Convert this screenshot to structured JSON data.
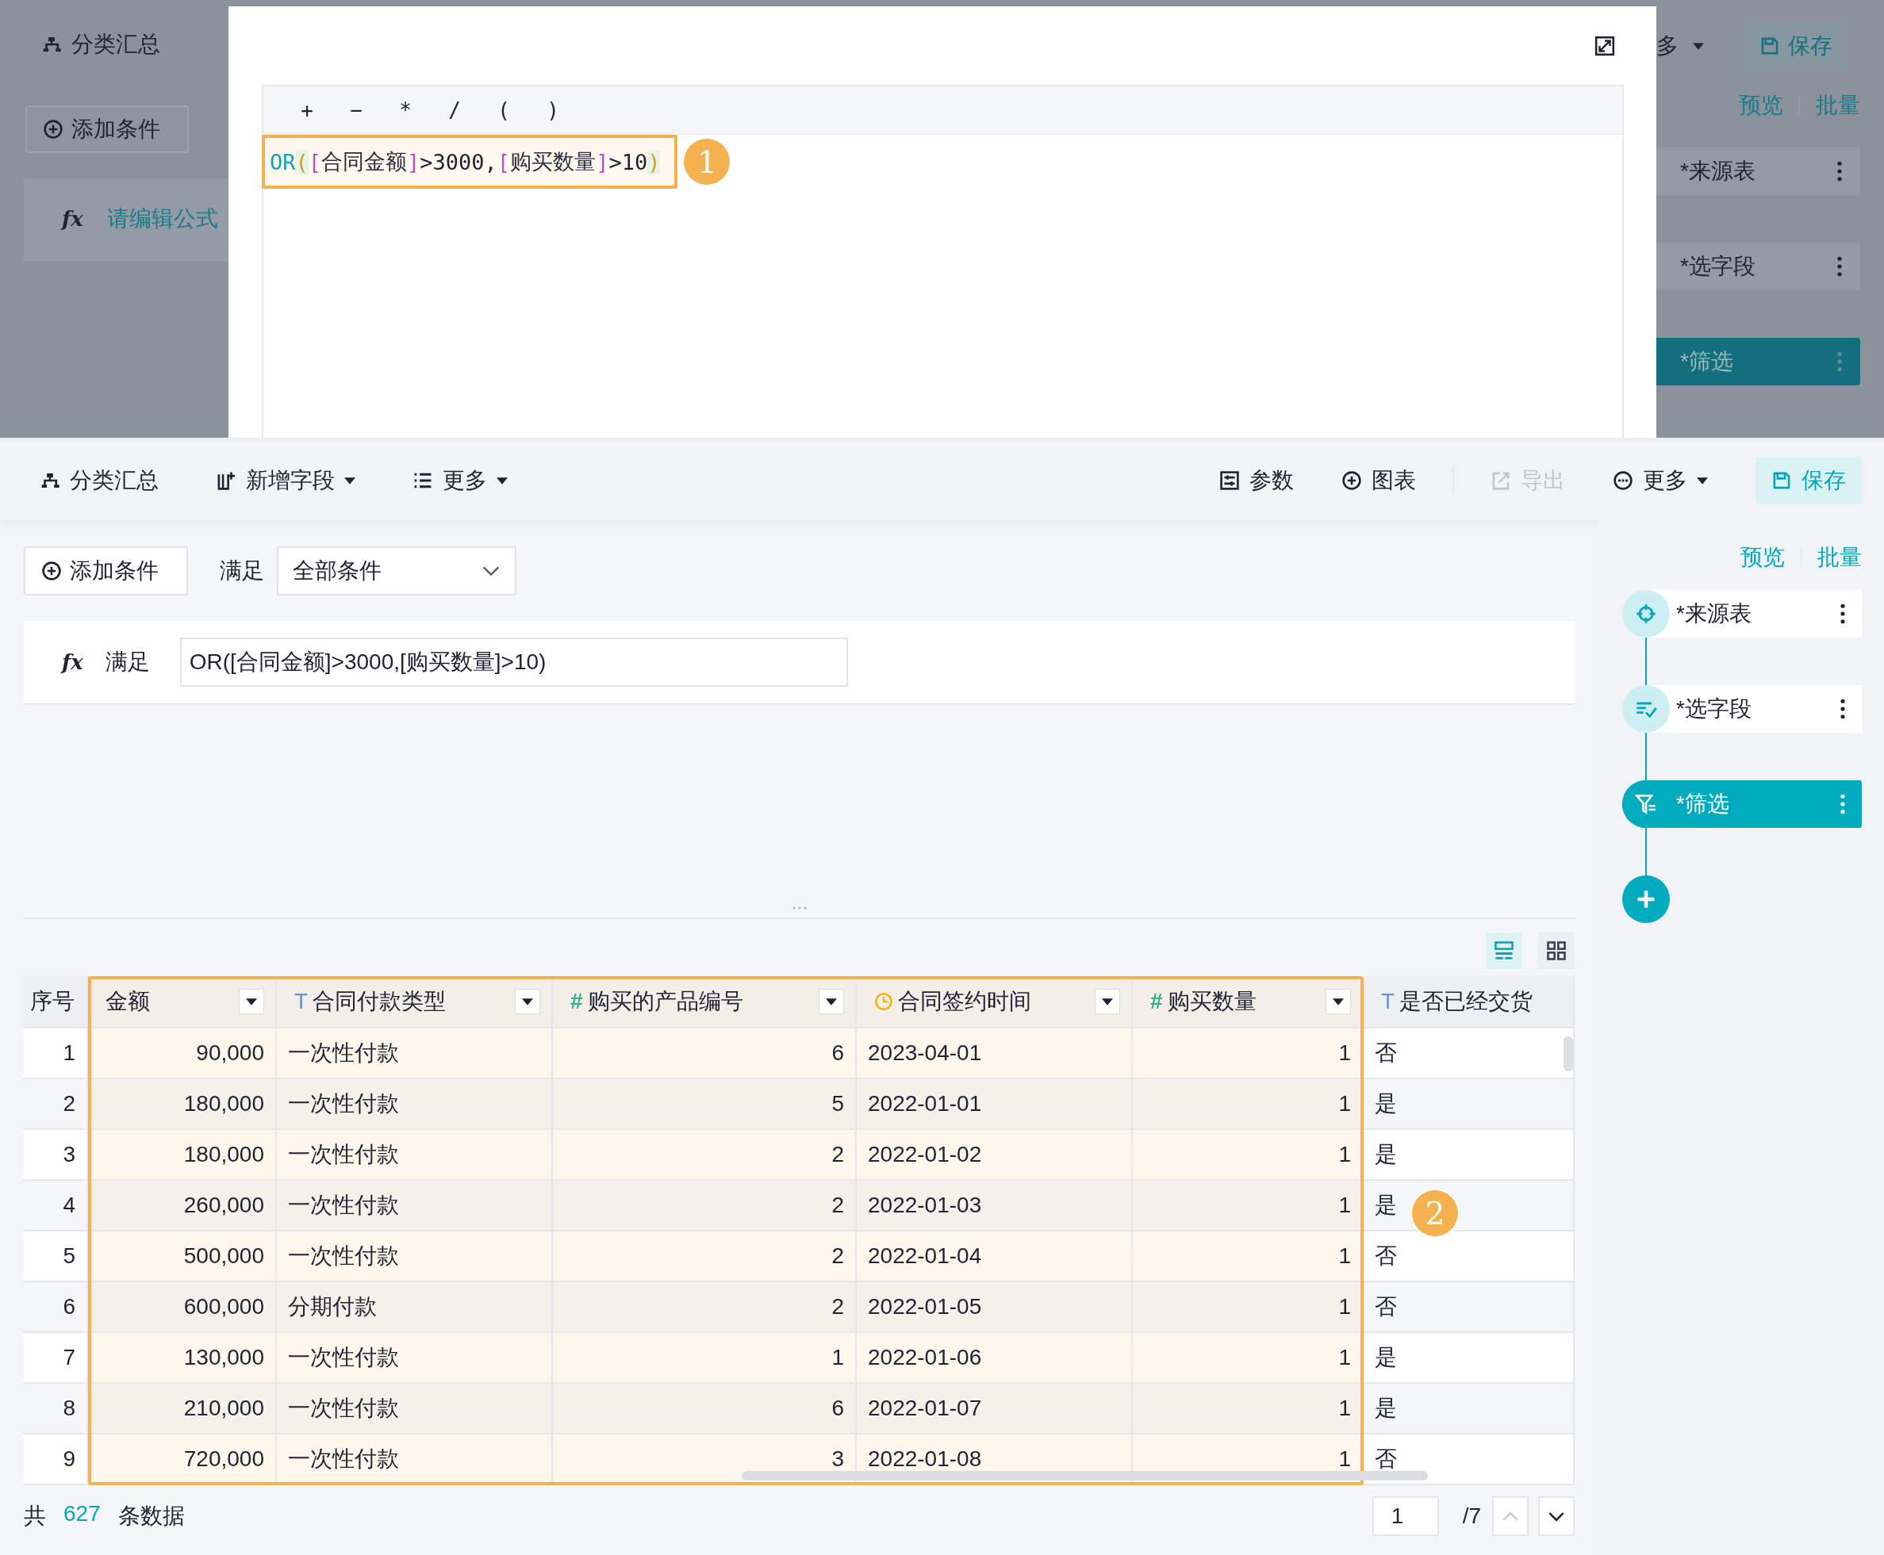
{
  "background": {
    "summary_label": "分类汇总",
    "add_condition": "添加条件",
    "formula_icon": "fx",
    "formula_placeholder": "请编辑公式",
    "more_label": "多",
    "save": "保存",
    "links": [
      "预览",
      "批量"
    ],
    "steps": [
      {
        "label": "*来源表",
        "selected": false
      },
      {
        "label": "*选字段",
        "selected": false
      },
      {
        "label": "*筛选",
        "selected": true
      }
    ]
  },
  "formula_dialog": {
    "operators": [
      "+",
      "−",
      "*",
      "/",
      "(",
      ")"
    ],
    "formula": [
      {
        "kind": "fn",
        "text": "OR"
      },
      {
        "kind": "paren",
        "text": "("
      },
      {
        "kind": "bracket",
        "text": "["
      },
      {
        "kind": "field",
        "text": "合同金额"
      },
      {
        "kind": "bracket",
        "text": "]"
      },
      {
        "kind": "plain",
        "text": ">3000,"
      },
      {
        "kind": "bracket",
        "text": "["
      },
      {
        "kind": "field",
        "text": "购买数量"
      },
      {
        "kind": "bracket",
        "text": "]"
      },
      {
        "kind": "plain",
        "text": ">10"
      },
      {
        "kind": "paren",
        "text": ")"
      }
    ],
    "callout": "1"
  },
  "toolbar": {
    "left": [
      {
        "label": "分类汇总",
        "kind": "tree",
        "dropdown": false,
        "disabled": false
      },
      {
        "label": "新增字段",
        "kind": "add-field",
        "dropdown": true,
        "disabled": false
      },
      {
        "label": "更多",
        "kind": "list",
        "dropdown": true,
        "disabled": false
      }
    ],
    "right": [
      {
        "label": "参数",
        "kind": "params",
        "dropdown": false,
        "disabled": false
      },
      {
        "label": "图表",
        "kind": "plus-circle",
        "dropdown": false,
        "disabled": false
      },
      {
        "label": "导出",
        "kind": "export",
        "dropdown": false,
        "disabled": true
      },
      {
        "label": "更多",
        "kind": "dots",
        "dropdown": true,
        "disabled": false
      }
    ],
    "save": "保存"
  },
  "filter": {
    "add_condition": "添加条件",
    "match_label": "满足",
    "match_value": "全部条件",
    "formula_icon": "fx",
    "formula_label": "满足",
    "formula": "OR([合同金额]>3000,[购买数量]>10)"
  },
  "view_toggle": [
    {
      "kind": "rows",
      "selected": true
    },
    {
      "kind": "grid",
      "selected": false
    }
  ],
  "table": {
    "columns": [
      {
        "label": "序号",
        "kind": "index",
        "menu": false,
        "highlighted": false
      },
      {
        "label": "金额",
        "kind": "amount",
        "menu": true,
        "highlighted": true
      },
      {
        "label": "合同付款类型",
        "kind": "text",
        "symbol": "T",
        "menu": true,
        "highlighted": true
      },
      {
        "label": "购买的产品编号",
        "kind": "number",
        "symbol": "#",
        "menu": true,
        "highlighted": true
      },
      {
        "label": "合同签约时间",
        "kind": "date",
        "menu": true,
        "highlighted": true
      },
      {
        "label": "购买数量",
        "kind": "number",
        "symbol": "#",
        "menu": true,
        "highlighted": true
      },
      {
        "label": "是否已经交货",
        "kind": "text",
        "symbol": "T",
        "menu": false,
        "highlighted": false
      }
    ],
    "rows": [
      [
        "1",
        "90,000",
        "一次性付款",
        "6",
        "2023-04-01",
        "1",
        "否"
      ],
      [
        "2",
        "180,000",
        "一次性付款",
        "5",
        "2022-01-01",
        "1",
        "是"
      ],
      [
        "3",
        "180,000",
        "一次性付款",
        "2",
        "2022-01-02",
        "1",
        "是"
      ],
      [
        "4",
        "260,000",
        "一次性付款",
        "2",
        "2022-01-03",
        "1",
        "是"
      ],
      [
        "5",
        "500,000",
        "一次性付款",
        "2",
        "2022-01-04",
        "1",
        "否"
      ],
      [
        "6",
        "600,000",
        "分期付款",
        "2",
        "2022-01-05",
        "1",
        "否"
      ],
      [
        "7",
        "130,000",
        "一次性付款",
        "1",
        "2022-01-06",
        "1",
        "是"
      ],
      [
        "8",
        "210,000",
        "一次性付款",
        "6",
        "2022-01-07",
        "1",
        "是"
      ],
      [
        "9",
        "720,000",
        "一次性付款",
        "3",
        "2022-01-08",
        "1",
        "否"
      ]
    ],
    "callout": "2"
  },
  "footer": {
    "prefix": "共",
    "total": "627",
    "suffix": "条数据",
    "page": "1",
    "pages": "/7",
    "prev_disabled": true,
    "next_disabled": false
  },
  "sidebar": {
    "links": [
      "预览",
      "批量"
    ],
    "steps": [
      {
        "label": "*来源表",
        "kind": "source",
        "selected": false
      },
      {
        "label": "*选字段",
        "kind": "fields",
        "selected": false
      },
      {
        "label": "*筛选",
        "kind": "filter",
        "selected": true
      }
    ]
  }
}
